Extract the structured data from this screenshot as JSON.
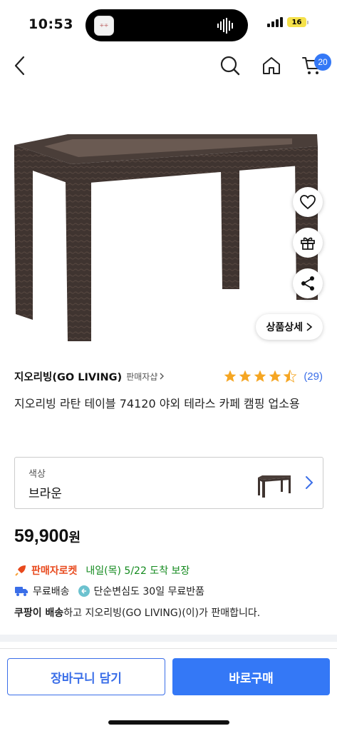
{
  "status_bar": {
    "time": "10:53",
    "battery": "16",
    "island_app_label": "ꔰꔰ"
  },
  "nav": {
    "cart_count": "20"
  },
  "product": {
    "detail_button_label": "상품상세",
    "seller_name": "지오리빙(GO LIVING)",
    "seller_link_label": "판매자샵",
    "rating_stars": 4.5,
    "rating_count": "(29)",
    "title": "지오리빙 라탄 테이블 74120 야외 테라스 카페 캠핑 업소용"
  },
  "option": {
    "label": "색상",
    "value": "브라운"
  },
  "price": {
    "amount": "59,900",
    "unit": "원"
  },
  "delivery": {
    "badge_label": "판매자로켓",
    "date_text": "내일(목) 5/22 도착 보장",
    "free_shipping": "무료배송",
    "return_policy": "단순변심도 30일 무료반품",
    "seller_note_bold": "쿠팡이 배송",
    "seller_note_rest": "하고 지오리빙(GO LIVING)(이)가 판매합니다."
  },
  "buttons": {
    "add_to_cart": "장바구니 담기",
    "buy_now": "바로구매"
  },
  "colors": {
    "accent": "#3478f6",
    "rocket": "#e8491d",
    "delivery_green": "#138a1e",
    "star": "#f5a623"
  }
}
